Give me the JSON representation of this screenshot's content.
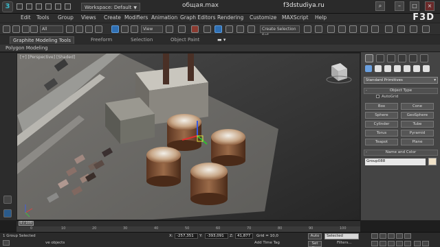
{
  "title_bar": {
    "workspace_label": "Workspace: Default",
    "file_title": "общая.max",
    "watermark": "f3dstudiya.ru",
    "brand": "F3D"
  },
  "menu": [
    "Edit",
    "Tools",
    "Group",
    "Views",
    "Create",
    "Modifiers",
    "Animation",
    "Graph Editors",
    "Rendering",
    "Customize",
    "MAXScript",
    "Help"
  ],
  "toolbar": {
    "filter_dropdown": "All",
    "refcoord_dropdown": "View",
    "named_sel_dropdown": "Create Selection Set"
  },
  "ribbon": {
    "tabs": [
      "Graphite Modeling Tools",
      "Freeform",
      "Selection",
      "Object Paint"
    ],
    "active_tab": "Graphite Modeling Tools",
    "panel_label": "Polygon Modeling"
  },
  "viewport": {
    "label": "[+] [Perspective] [Shaded]"
  },
  "command_panel": {
    "category_dropdown": "Standard Primitives",
    "object_type_title": "Object Type",
    "autogrid_label": "AutoGrid",
    "primitives": [
      "Box",
      "Cone",
      "Sphere",
      "GeoSphere",
      "Cylinder",
      "Tube",
      "Torus",
      "Pyramid",
      "Teapot",
      "Plane"
    ],
    "name_color_title": "Name and Color",
    "object_name": "Group088",
    "object_color": "#f0e2c8"
  },
  "timeline": {
    "slider_label": "0 / 100",
    "ticks": [
      "0",
      "10",
      "20",
      "30",
      "40",
      "50",
      "60",
      "70",
      "80",
      "90",
      "100"
    ]
  },
  "status_bar": {
    "selection_text": "1 Group Selected",
    "hint_text": "ve objects",
    "x_label": "X:",
    "x_value": "-257,351",
    "y_label": "Y:",
    "y_value": "-393,091",
    "z_label": "Z:",
    "z_value": "41,877",
    "grid_label": "Grid = 10,0",
    "add_time_tag": "Add Time Tag",
    "auto_key": "Auto",
    "set_key": "Set K...",
    "selected_dropdown": "Selected",
    "filters": "Filters..."
  }
}
